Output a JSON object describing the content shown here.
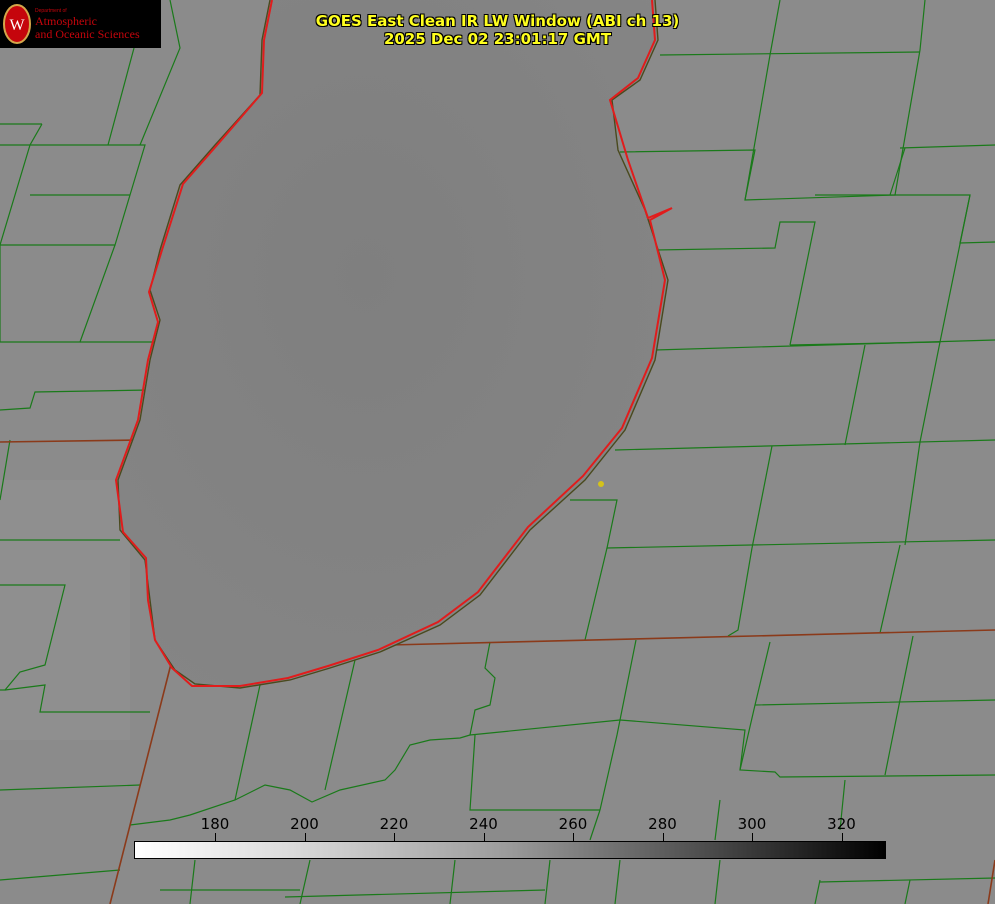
{
  "header": {
    "line1": "GOES East Clean IR LW Window (ABI ch 13)",
    "line2": "2025 Dec 02 23:01:17 GMT"
  },
  "logo": {
    "dept_label": "Department of",
    "name_line1": "Atmospheric",
    "name_line2": "and Oceanic Sciences",
    "seal_letter": "W"
  },
  "colorbar": {
    "ticks": [
      "180",
      "200",
      "220",
      "240",
      "260",
      "280",
      "300",
      "320"
    ],
    "gradient": "white to black"
  },
  "colors": {
    "lake_outline": "#e11c1c",
    "county_lines": "#1a7a1a",
    "state_lines": "#8b3a1a",
    "title_text": "#ffff1e",
    "marker": "#d4c21a"
  }
}
